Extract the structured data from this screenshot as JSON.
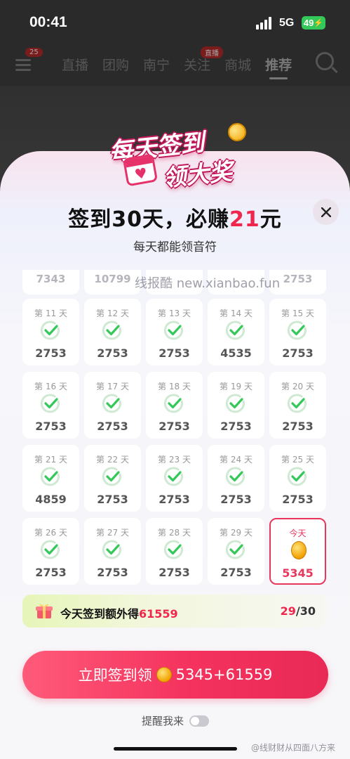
{
  "status_bar": {
    "time": "00:41",
    "network": "5G",
    "battery": "49"
  },
  "background_app": {
    "tabs": [
      "关注",
      "直播",
      "团购",
      "南宁",
      "关注",
      "商城",
      "推荐"
    ],
    "active_tab_index": 6,
    "badges": {
      "menu": "25",
      "tab4": "直播"
    }
  },
  "modal": {
    "banner_line1": "每天签到",
    "banner_line2": "领大奖",
    "title_prefix": "签到30天，必赚",
    "title_amount": "21",
    "title_suffix": "元",
    "subtitle": "每天都能领音符",
    "watermark": "线报酷 new.xianbao.fun",
    "partial_row_values": [
      "7343",
      "10799",
      "",
      "",
      "2753"
    ],
    "days": [
      {
        "label": "第 11 天",
        "value": "2753",
        "checked": true
      },
      {
        "label": "第 12 天",
        "value": "2753",
        "checked": true
      },
      {
        "label": "第 13 天",
        "value": "2753",
        "checked": true
      },
      {
        "label": "第 14 天",
        "value": "4535",
        "checked": true
      },
      {
        "label": "第 15 天",
        "value": "2753",
        "checked": true
      },
      {
        "label": "第 16 天",
        "value": "2753",
        "checked": true
      },
      {
        "label": "第 17 天",
        "value": "2753",
        "checked": true
      },
      {
        "label": "第 18 天",
        "value": "2753",
        "checked": true
      },
      {
        "label": "第 19 天",
        "value": "2753",
        "checked": true
      },
      {
        "label": "第 20 天",
        "value": "2753",
        "checked": true
      },
      {
        "label": "第 21 天",
        "value": "4859",
        "checked": true
      },
      {
        "label": "第 22 天",
        "value": "2753",
        "checked": true
      },
      {
        "label": "第 23 天",
        "value": "2753",
        "checked": true
      },
      {
        "label": "第 24 天",
        "value": "2753",
        "checked": true
      },
      {
        "label": "第 25 天",
        "value": "2753",
        "checked": true
      },
      {
        "label": "第 26 天",
        "value": "2753",
        "checked": true
      },
      {
        "label": "第 27 天",
        "value": "2753",
        "checked": true
      },
      {
        "label": "第 28 天",
        "value": "2753",
        "checked": true
      },
      {
        "label": "第 29 天",
        "value": "2753",
        "checked": true
      },
      {
        "label": "今天",
        "value": "5345",
        "checked": false,
        "today": true
      }
    ],
    "bonus": {
      "text_prefix": "今天签到额外得",
      "amount": "61559",
      "progress_current": "29",
      "progress_total": "/30"
    },
    "cta": {
      "label_prefix": "立即签到领",
      "label_amount": "5345+61559"
    },
    "remind_label": "提醒我来",
    "remind_enabled": false
  },
  "corner_watermark": "@线财财从四面八方来",
  "colors": {
    "accent": "#f0264d",
    "check_green": "#34c759",
    "cta_start": "#ff5a7a",
    "cta_end": "#e92a56"
  }
}
